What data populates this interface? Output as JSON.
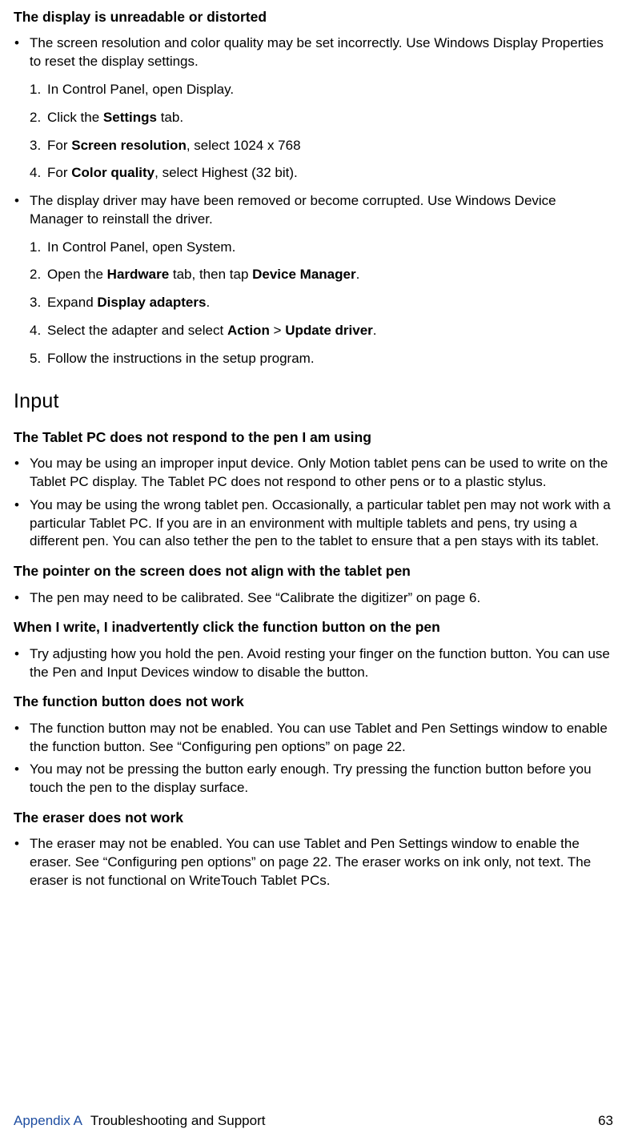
{
  "issue1": {
    "heading": "The display is unreadable or distorted",
    "bullet1": "The screen resolution and color quality may be set incorrectly. Use Windows Display Properties to reset the display settings.",
    "steps1": {
      "s1": "In Control Panel, open Display.",
      "s2_pre": "Click the ",
      "s2_b": "Settings",
      "s2_post": " tab.",
      "s3_pre": "For ",
      "s3_b": "Screen resolution",
      "s3_post": ", select 1024 x 768",
      "s4_pre": "For ",
      "s4_b": "Color quality",
      "s4_post": ", select Highest (32 bit)."
    },
    "bullet2": "The display driver may have been removed or become corrupted. Use Windows Device Manager to reinstall the driver.",
    "steps2": {
      "s1": "In Control Panel, open System.",
      "s2_pre": "Open the ",
      "s2_b1": "Hardware",
      "s2_mid": " tab, then tap ",
      "s2_b2": "Device Manager",
      "s2_post": ".",
      "s3_pre": "Expand ",
      "s3_b": "Display adapters",
      "s3_post": ".",
      "s4_pre": "Select the adapter and select ",
      "s4_b1": "Action",
      "s4_mid": " > ",
      "s4_b2": "Update driver",
      "s4_post": ".",
      "s5": "Follow the instructions in the setup program."
    }
  },
  "section_input": "Input",
  "issue2": {
    "heading": "The Tablet PC does not respond to the pen I am using",
    "bullet1": "You may be using an improper input device. Only Motion tablet pens can be used to write on the Tablet PC display. The Tablet PC does not respond to other pens or to a plastic stylus.",
    "bullet2": "You may be using the wrong tablet pen. Occasionally, a particular tablet pen may not work with a particular Tablet PC. If you are in an environment with multiple tablets and pens, try using a different pen. You can also tether the pen to the tablet to ensure that a pen stays with its tablet."
  },
  "issue3": {
    "heading": "The pointer on the screen does not align with the tablet pen",
    "bullet1": "The pen may need to be calibrated. See “Calibrate the digitizer” on page 6."
  },
  "issue4": {
    "heading": "When I write, I inadvertently click the function button on the pen",
    "bullet1": "Try adjusting how you hold the pen. Avoid resting your finger on the function button. You can use the Pen and Input Devices window to disable the button."
  },
  "issue5": {
    "heading": "The function button does not work",
    "bullet1": "The function button may not be enabled. You can use Tablet and Pen Settings window to enable the function button. See “Configuring pen options” on page 22.",
    "bullet2": "You may not be pressing the button early enough. Try pressing the function button before you touch the pen to the display surface."
  },
  "issue6": {
    "heading": "The eraser does not work",
    "bullet1": "The eraser may not be enabled. You can use Tablet and Pen Settings window to enable the eraser. See “Configuring pen options” on page 22. The eraser works on ink only, not text. The eraser is not functional on WriteTouch Tablet PCs."
  },
  "footer": {
    "appendix": "Appendix A",
    "title": "Troubleshooting and Support",
    "page": "63"
  }
}
